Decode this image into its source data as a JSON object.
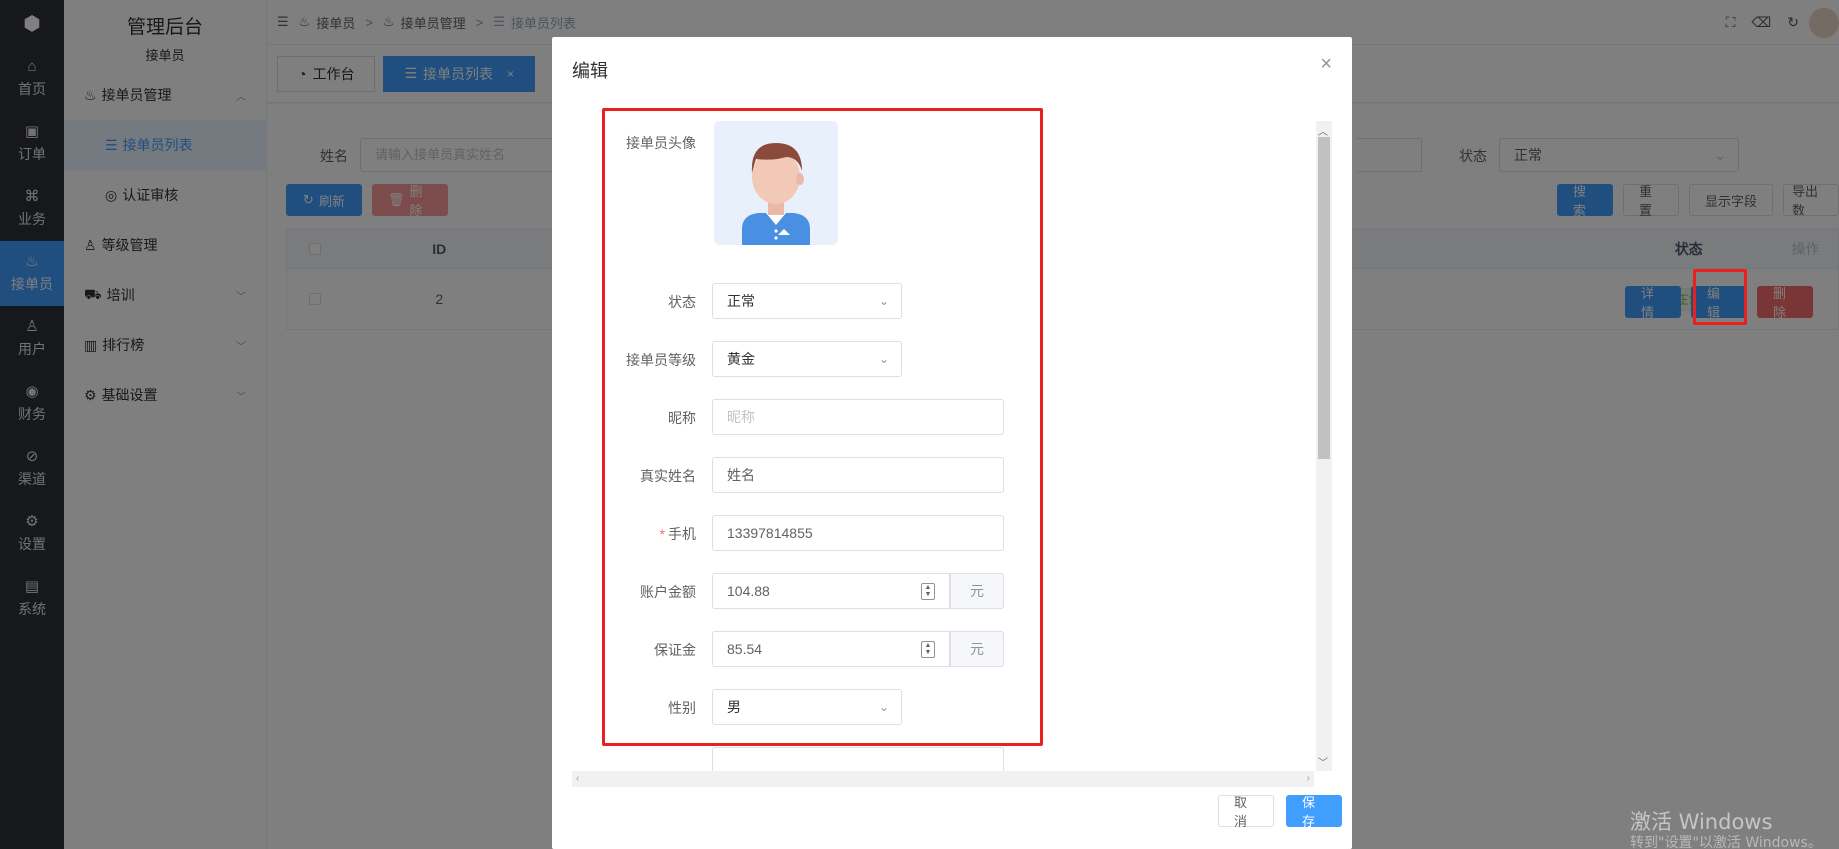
{
  "rail": {
    "items": [
      {
        "icon": "⌂",
        "label": "首页"
      },
      {
        "icon": "▣",
        "label": "订单"
      },
      {
        "icon": "⌘",
        "label": "业务"
      },
      {
        "icon": "♨",
        "label": "接单员"
      },
      {
        "icon": "♙",
        "label": "用户"
      },
      {
        "icon": "◉",
        "label": "财务"
      },
      {
        "icon": "⊘",
        "label": "渠道"
      },
      {
        "icon": "⚙",
        "label": "设置"
      },
      {
        "icon": "▤",
        "label": "系统"
      }
    ]
  },
  "menu": {
    "app_title": "管理后台",
    "section": "接单员",
    "group_jdygl": "接单员管理",
    "sub_list": "接单员列表",
    "sub_review": "认证审核",
    "group_level": "等级管理",
    "group_train": "培训",
    "group_rank": "排行榜",
    "group_base": "基础设置"
  },
  "breadcrumb": {
    "c1": "接单员",
    "c2": "接单员管理",
    "c3": "接单员列表"
  },
  "tabs": {
    "t1": "工作台",
    "t2": "接单员列表"
  },
  "search": {
    "name_label": "姓名",
    "name_placeholder": "请输入接单员真实姓名",
    "status_label": "状态",
    "status_value": "正常"
  },
  "actions": {
    "refresh": "刷新",
    "delete": "删除",
    "search": "搜索",
    "reset": "重置",
    "show_fields": "显示字段",
    "export": "导出数"
  },
  "table": {
    "col_id": "ID",
    "col_status": "状态",
    "col_ops": "操作",
    "row_id": "2",
    "row_status": "正常",
    "btn_detail": "详情",
    "btn_edit": "编辑",
    "btn_delete": "删除"
  },
  "dialog": {
    "title": "编辑",
    "avatar_label": "接单员头像",
    "status_label": "状态",
    "status_value": "正常",
    "level_label": "接单员等级",
    "level_value": "黄金",
    "nickname_label": "昵称",
    "nickname_placeholder": "昵称",
    "realname_label": "真实姓名",
    "realname_value": "姓名",
    "phone_label": "手机",
    "phone_value": "13397814855",
    "balance_label": "账户金额",
    "balance_value": "104.88",
    "balance_unit": "元",
    "deposit_label": "保证金",
    "deposit_value": "85.54",
    "deposit_unit": "元",
    "gender_label": "性别",
    "gender_value": "男",
    "cancel": "取消",
    "save": "保存"
  },
  "watermark": {
    "line1": "激活 Windows",
    "line2": "转到\"设置\"以激活 Windows。"
  }
}
